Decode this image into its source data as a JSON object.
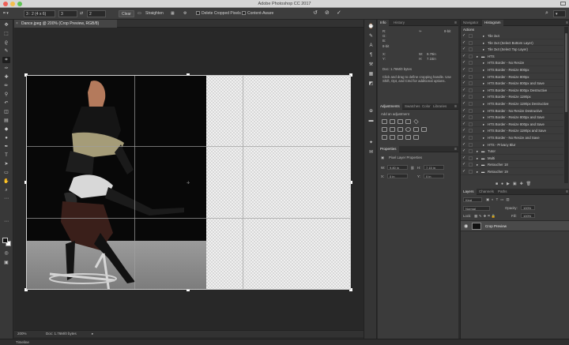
{
  "window": {
    "title": "Adobe Photoshop CC 2017"
  },
  "options": {
    "preset": "3 : 2 (4 x 6)",
    "ratio_w": "3",
    "ratio_h": "2",
    "clear_label": "Clear",
    "straighten_label": "Straighten",
    "delete_cropped_label": "Delete Cropped Pixels",
    "content_aware_label": "Content-Aware"
  },
  "document": {
    "tab_label": "Dance.jpeg @ 200% (Crop Preview, RGB/8)",
    "zoom": "200%",
    "doc_size": "Doc: 1.76M/0 bytes"
  },
  "bottom": {
    "timeline_label": "Timeline"
  },
  "info": {
    "tabs": [
      "Info",
      "History"
    ],
    "r_label": "R:",
    "g_label": "G:",
    "b_label": "B:",
    "bit": "8-bit",
    "x_label": "X:",
    "y_label": "Y:",
    "w_label": "W:",
    "h_label": "H:",
    "w_value": "9.79in",
    "h_value": "7.15in",
    "doc": "Doc: 1.76M/0 bytes",
    "hint": "Click and drag to define cropping handle. Use Shift, Opt, and Cmd for additional options."
  },
  "adjustments": {
    "tabs": [
      "Adjustments",
      "Swatches",
      "Color",
      "Libraries"
    ],
    "add_label": "Add an adjustment"
  },
  "properties": {
    "title": "Properties",
    "kind": "Pixel Layer Properties",
    "w_label": "W:",
    "w_value": "9.80 in",
    "h_label": "H:",
    "h_value": "7.15 in",
    "x_label": "X:",
    "x_value": "0 in",
    "y_label": "Y:",
    "y_value": "0 in",
    "go_label": "GO"
  },
  "actions": {
    "tabs": [
      "Navigator",
      "Histogram"
    ],
    "title": "Actions",
    "rows": [
      {
        "label": "Tile 3x4",
        "level": 2,
        "folder": false
      },
      {
        "label": "Tile 3x4 (Select Bottom Layer)",
        "level": 2,
        "folder": false
      },
      {
        "label": "Tile 3x4 (Select Top Layer)",
        "level": 2,
        "folder": false
      },
      {
        "label": "HTS",
        "level": 1,
        "folder": true
      },
      {
        "label": "HTS Border - No Resize",
        "level": 2,
        "folder": false
      },
      {
        "label": "HTS Border - Resize 800px",
        "level": 2,
        "folder": false
      },
      {
        "label": "HTS Border - Resize 800px",
        "level": 2,
        "folder": false
      },
      {
        "label": "HTS Border - Resize 800px and Save",
        "level": 2,
        "folder": false
      },
      {
        "label": "HTS Border - Resize 800px Destructive",
        "level": 2,
        "folder": false
      },
      {
        "label": "HTS Border - Resize 1190px",
        "level": 2,
        "folder": false
      },
      {
        "label": "HTS Border - Resize 1190px Destructive",
        "level": 2,
        "folder": false
      },
      {
        "label": "HTS Border - No Resize Destructive",
        "level": 2,
        "folder": false
      },
      {
        "label": "HTS Border - Resize 800px and Save",
        "level": 2,
        "folder": false
      },
      {
        "label": "HTS Border - Resize 800px and Save",
        "level": 2,
        "folder": false
      },
      {
        "label": "HTS Border - Resize 1190px and Save",
        "level": 2,
        "folder": false
      },
      {
        "label": "HTS Border - No Resize and Save",
        "level": 2,
        "folder": false
      },
      {
        "label": "HTS - Privacy Blur",
        "level": 2,
        "folder": false
      },
      {
        "label": "Tutor",
        "level": 1,
        "folder": true
      },
      {
        "label": "Multi",
        "level": 1,
        "folder": true
      },
      {
        "label": "Retoucher 18",
        "level": 1,
        "folder": true
      },
      {
        "label": "Retoucher 19",
        "level": 1,
        "folder": true
      }
    ]
  },
  "layers": {
    "tabs": [
      "Layers",
      "Channels",
      "Paths"
    ],
    "kind": "Kind",
    "blend": "Normal",
    "opacity_label": "Opacity:",
    "opacity_value": "100%",
    "lock_label": "Lock:",
    "fill_label": "Fill:",
    "fill_value": "100%",
    "layer_name": "Crop Preview"
  }
}
